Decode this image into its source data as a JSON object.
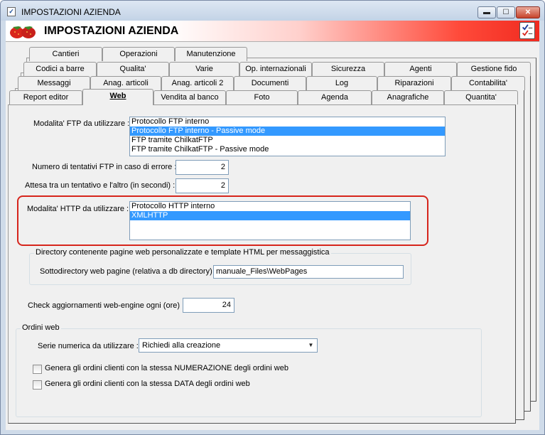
{
  "window": {
    "title": "IMPOSTAZIONI AZIENDA",
    "min_glyph": "▬",
    "max_glyph": "☐",
    "close_glyph": "✕"
  },
  "header": {
    "title": "IMPOSTAZIONI AZIENDA",
    "logo_icon": "strawberry-icon",
    "right_icon": "checklist-icon"
  },
  "tabs": {
    "row1": [
      "Cantieri",
      "Operazioni",
      "Manutenzione"
    ],
    "row2": [
      "Codici a barre",
      "Qualita'",
      "Varie",
      "Op. internazionali",
      "Sicurezza",
      "Agenti",
      "Gestione fido"
    ],
    "row3": [
      "Messaggi",
      "Anag. articoli",
      "Anag. articoli 2",
      "Documenti",
      "Log",
      "Riparazioni",
      "Contabilita'"
    ],
    "row4": [
      "Report editor",
      "Web",
      "Vendita al banco",
      "Foto",
      "Agenda",
      "Anagrafiche",
      "Quantita'"
    ],
    "active": "Web"
  },
  "ftp": {
    "label": "Modalita' FTP da utilizzare :",
    "options": [
      {
        "text": "Protocollo FTP interno",
        "selected": false
      },
      {
        "text": "Protocollo FTP interno - Passive mode",
        "selected": true
      },
      {
        "text": "FTP tramite ChilkatFTP",
        "selected": false
      },
      {
        "text": "FTP tramite ChilkatFTP - Passive mode",
        "selected": false
      }
    ]
  },
  "retries": {
    "label": "Numero di tentativi FTP in caso di errore :",
    "value": "2"
  },
  "wait": {
    "label": "Attesa tra un tentativo e l'altro (in secondi) :",
    "value": "2"
  },
  "http": {
    "label": "Modalita' HTTP da utilizzare :",
    "options": [
      {
        "text": "Protocollo HTTP interno",
        "selected": false
      },
      {
        "text": "XMLHTTP",
        "selected": true
      }
    ]
  },
  "directory": {
    "group_title": "Directory contenente pagine web personalizzate e template HTML per messaggistica",
    "label": "Sottodirectory web pagine (relativa a db directory) :",
    "value": "manuale_Files\\WebPages"
  },
  "check_updates": {
    "label": "Check aggiornamenti web-engine ogni (ore) :",
    "value": "24"
  },
  "orders": {
    "group_title": "Ordini web",
    "series_label": "Serie numerica da utilizzare :",
    "series_value": "Richiedi alla creazione",
    "check1": "Genera gli ordini clienti con la stessa NUMERAZIONE degli ordini web",
    "check2": "Genera gli ordini clienti con la stessa DATA degli ordini web",
    "check1_checked": false,
    "check2_checked": false
  },
  "colors": {
    "selection": "#3399ff",
    "highlight_ring": "#d6251c",
    "header_gradient_end": "#f02a1f"
  }
}
